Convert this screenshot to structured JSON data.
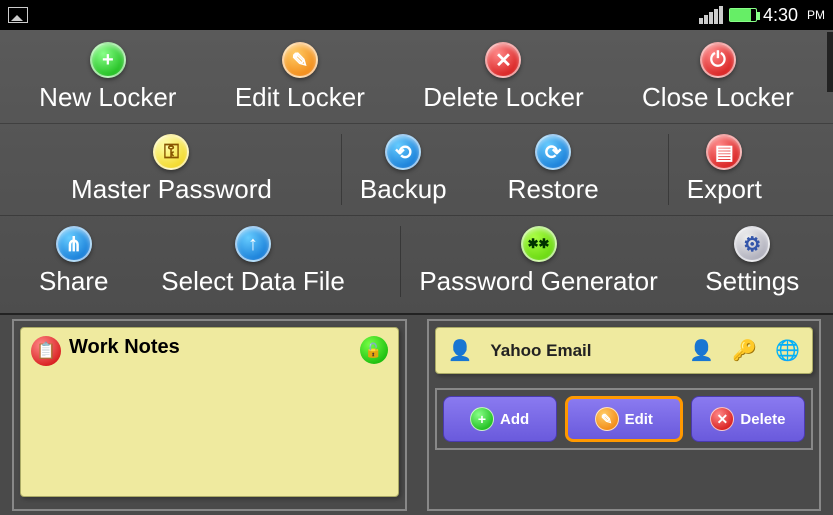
{
  "status": {
    "time": "4:30",
    "period": "PM"
  },
  "menu": {
    "row1": [
      {
        "label": "New Locker",
        "icon": "plus",
        "color": "green"
      },
      {
        "label": "Edit Locker",
        "icon": "pencil",
        "color": "orange"
      },
      {
        "label": "Delete Locker",
        "icon": "x",
        "color": "red"
      },
      {
        "label": "Close Locker",
        "icon": "power",
        "color": "red"
      }
    ],
    "row2": [
      {
        "label": "Master Password",
        "icon": "key",
        "color": "yellow"
      },
      {
        "label": "Backup",
        "icon": "refresh",
        "color": "blue"
      },
      {
        "label": "Restore",
        "icon": "reload",
        "color": "blue"
      },
      {
        "label": "Export",
        "icon": "doc",
        "color": "red"
      }
    ],
    "row3": [
      {
        "label": "Share",
        "icon": "share",
        "color": "blue"
      },
      {
        "label": "Select Data File",
        "icon": "up",
        "color": "blue"
      },
      {
        "label": "Password Generator",
        "icon": "lock",
        "color": "lime"
      },
      {
        "label": "Settings",
        "icon": "gear",
        "color": "silver"
      }
    ]
  },
  "left_panel": {
    "note_title": "Work Notes"
  },
  "right_panel": {
    "account_name": "Yahoo Email",
    "buttons": {
      "add": "Add",
      "edit": "Edit",
      "delete": "Delete"
    }
  }
}
